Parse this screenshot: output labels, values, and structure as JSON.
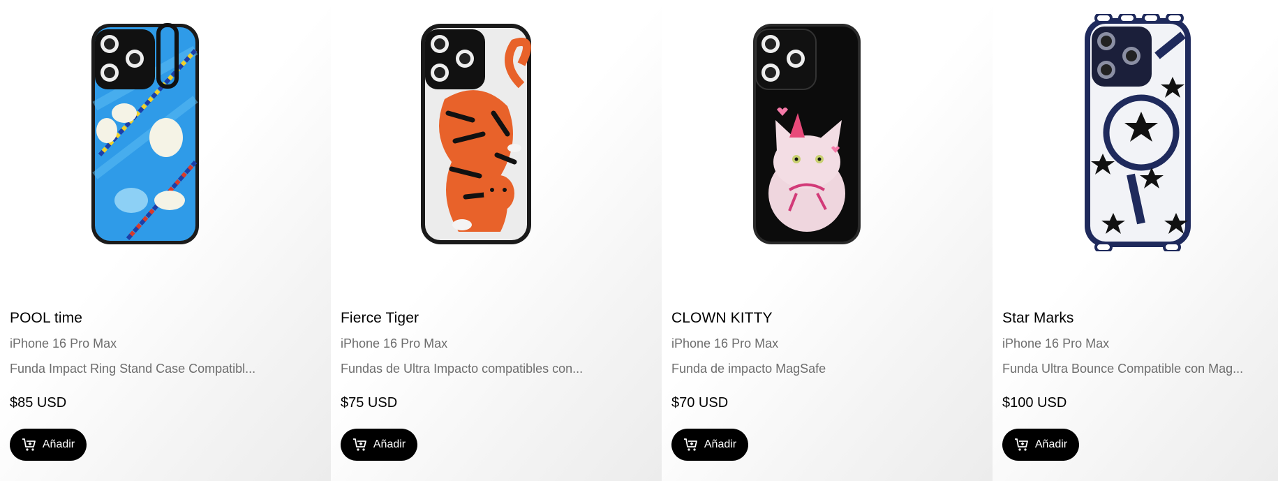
{
  "products": [
    {
      "title": "POOL time",
      "model": "iPhone 16 Pro Max",
      "description": "Funda Impact Ring Stand Case Compatibl...",
      "price": "$85 USD",
      "button_label": "Añadir",
      "image_icon": "phone-case-pool-ducks",
      "case_color": "#2f8fe3"
    },
    {
      "title": "Fierce Tiger",
      "model": "iPhone 16 Pro Max",
      "description": "Fundas de Ultra Impacto compatibles con...",
      "price": "$75 USD",
      "button_label": "Añadir",
      "image_icon": "phone-case-tiger",
      "case_color": "#e8622a"
    },
    {
      "title": "CLOWN KITTY",
      "model": "iPhone 16 Pro Max",
      "description": "Funda de impacto MagSafe",
      "price": "$70 USD",
      "button_label": "Añadir",
      "image_icon": "phone-case-kitty",
      "case_color": "#0c0c0c"
    },
    {
      "title": "Star Marks",
      "model": "iPhone 16 Pro Max",
      "description": "Funda Ultra Bounce Compatible con Mag...",
      "price": "$100 USD",
      "button_label": "Añadir",
      "image_icon": "phone-case-stars",
      "case_color": "#1f2a5c"
    }
  ],
  "colors": {
    "button_bg": "#000000",
    "button_text": "#ffffff",
    "secondary_text": "#6d6d6d"
  }
}
